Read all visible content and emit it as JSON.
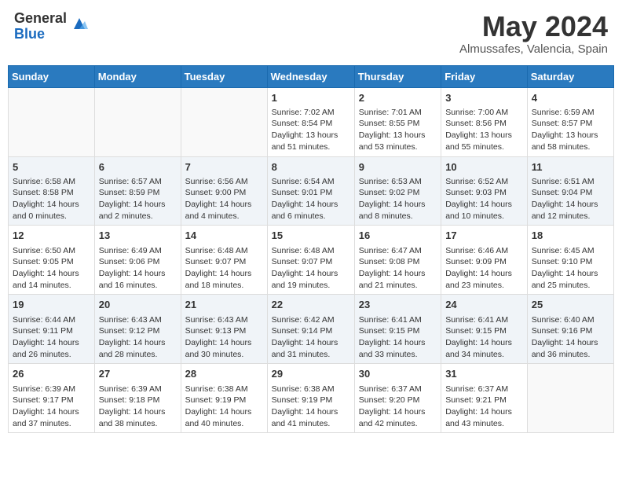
{
  "header": {
    "logo_general": "General",
    "logo_blue": "Blue",
    "title": "May 2024",
    "location": "Almussafes, Valencia, Spain"
  },
  "days_of_week": [
    "Sunday",
    "Monday",
    "Tuesday",
    "Wednesday",
    "Thursday",
    "Friday",
    "Saturday"
  ],
  "weeks": [
    [
      {
        "day": "",
        "sunrise": "",
        "sunset": "",
        "daylight": ""
      },
      {
        "day": "",
        "sunrise": "",
        "sunset": "",
        "daylight": ""
      },
      {
        "day": "",
        "sunrise": "",
        "sunset": "",
        "daylight": ""
      },
      {
        "day": "1",
        "sunrise": "Sunrise: 7:02 AM",
        "sunset": "Sunset: 8:54 PM",
        "daylight": "Daylight: 13 hours and 51 minutes."
      },
      {
        "day": "2",
        "sunrise": "Sunrise: 7:01 AM",
        "sunset": "Sunset: 8:55 PM",
        "daylight": "Daylight: 13 hours and 53 minutes."
      },
      {
        "day": "3",
        "sunrise": "Sunrise: 7:00 AM",
        "sunset": "Sunset: 8:56 PM",
        "daylight": "Daylight: 13 hours and 55 minutes."
      },
      {
        "day": "4",
        "sunrise": "Sunrise: 6:59 AM",
        "sunset": "Sunset: 8:57 PM",
        "daylight": "Daylight: 13 hours and 58 minutes."
      }
    ],
    [
      {
        "day": "5",
        "sunrise": "Sunrise: 6:58 AM",
        "sunset": "Sunset: 8:58 PM",
        "daylight": "Daylight: 14 hours and 0 minutes."
      },
      {
        "day": "6",
        "sunrise": "Sunrise: 6:57 AM",
        "sunset": "Sunset: 8:59 PM",
        "daylight": "Daylight: 14 hours and 2 minutes."
      },
      {
        "day": "7",
        "sunrise": "Sunrise: 6:56 AM",
        "sunset": "Sunset: 9:00 PM",
        "daylight": "Daylight: 14 hours and 4 minutes."
      },
      {
        "day": "8",
        "sunrise": "Sunrise: 6:54 AM",
        "sunset": "Sunset: 9:01 PM",
        "daylight": "Daylight: 14 hours and 6 minutes."
      },
      {
        "day": "9",
        "sunrise": "Sunrise: 6:53 AM",
        "sunset": "Sunset: 9:02 PM",
        "daylight": "Daylight: 14 hours and 8 minutes."
      },
      {
        "day": "10",
        "sunrise": "Sunrise: 6:52 AM",
        "sunset": "Sunset: 9:03 PM",
        "daylight": "Daylight: 14 hours and 10 minutes."
      },
      {
        "day": "11",
        "sunrise": "Sunrise: 6:51 AM",
        "sunset": "Sunset: 9:04 PM",
        "daylight": "Daylight: 14 hours and 12 minutes."
      }
    ],
    [
      {
        "day": "12",
        "sunrise": "Sunrise: 6:50 AM",
        "sunset": "Sunset: 9:05 PM",
        "daylight": "Daylight: 14 hours and 14 minutes."
      },
      {
        "day": "13",
        "sunrise": "Sunrise: 6:49 AM",
        "sunset": "Sunset: 9:06 PM",
        "daylight": "Daylight: 14 hours and 16 minutes."
      },
      {
        "day": "14",
        "sunrise": "Sunrise: 6:48 AM",
        "sunset": "Sunset: 9:07 PM",
        "daylight": "Daylight: 14 hours and 18 minutes."
      },
      {
        "day": "15",
        "sunrise": "Sunrise: 6:48 AM",
        "sunset": "Sunset: 9:07 PM",
        "daylight": "Daylight: 14 hours and 19 minutes."
      },
      {
        "day": "16",
        "sunrise": "Sunrise: 6:47 AM",
        "sunset": "Sunset: 9:08 PM",
        "daylight": "Daylight: 14 hours and 21 minutes."
      },
      {
        "day": "17",
        "sunrise": "Sunrise: 6:46 AM",
        "sunset": "Sunset: 9:09 PM",
        "daylight": "Daylight: 14 hours and 23 minutes."
      },
      {
        "day": "18",
        "sunrise": "Sunrise: 6:45 AM",
        "sunset": "Sunset: 9:10 PM",
        "daylight": "Daylight: 14 hours and 25 minutes."
      }
    ],
    [
      {
        "day": "19",
        "sunrise": "Sunrise: 6:44 AM",
        "sunset": "Sunset: 9:11 PM",
        "daylight": "Daylight: 14 hours and 26 minutes."
      },
      {
        "day": "20",
        "sunrise": "Sunrise: 6:43 AM",
        "sunset": "Sunset: 9:12 PM",
        "daylight": "Daylight: 14 hours and 28 minutes."
      },
      {
        "day": "21",
        "sunrise": "Sunrise: 6:43 AM",
        "sunset": "Sunset: 9:13 PM",
        "daylight": "Daylight: 14 hours and 30 minutes."
      },
      {
        "day": "22",
        "sunrise": "Sunrise: 6:42 AM",
        "sunset": "Sunset: 9:14 PM",
        "daylight": "Daylight: 14 hours and 31 minutes."
      },
      {
        "day": "23",
        "sunrise": "Sunrise: 6:41 AM",
        "sunset": "Sunset: 9:15 PM",
        "daylight": "Daylight: 14 hours and 33 minutes."
      },
      {
        "day": "24",
        "sunrise": "Sunrise: 6:41 AM",
        "sunset": "Sunset: 9:15 PM",
        "daylight": "Daylight: 14 hours and 34 minutes."
      },
      {
        "day": "25",
        "sunrise": "Sunrise: 6:40 AM",
        "sunset": "Sunset: 9:16 PM",
        "daylight": "Daylight: 14 hours and 36 minutes."
      }
    ],
    [
      {
        "day": "26",
        "sunrise": "Sunrise: 6:39 AM",
        "sunset": "Sunset: 9:17 PM",
        "daylight": "Daylight: 14 hours and 37 minutes."
      },
      {
        "day": "27",
        "sunrise": "Sunrise: 6:39 AM",
        "sunset": "Sunset: 9:18 PM",
        "daylight": "Daylight: 14 hours and 38 minutes."
      },
      {
        "day": "28",
        "sunrise": "Sunrise: 6:38 AM",
        "sunset": "Sunset: 9:19 PM",
        "daylight": "Daylight: 14 hours and 40 minutes."
      },
      {
        "day": "29",
        "sunrise": "Sunrise: 6:38 AM",
        "sunset": "Sunset: 9:19 PM",
        "daylight": "Daylight: 14 hours and 41 minutes."
      },
      {
        "day": "30",
        "sunrise": "Sunrise: 6:37 AM",
        "sunset": "Sunset: 9:20 PM",
        "daylight": "Daylight: 14 hours and 42 minutes."
      },
      {
        "day": "31",
        "sunrise": "Sunrise: 6:37 AM",
        "sunset": "Sunset: 9:21 PM",
        "daylight": "Daylight: 14 hours and 43 minutes."
      },
      {
        "day": "",
        "sunrise": "",
        "sunset": "",
        "daylight": ""
      }
    ]
  ]
}
